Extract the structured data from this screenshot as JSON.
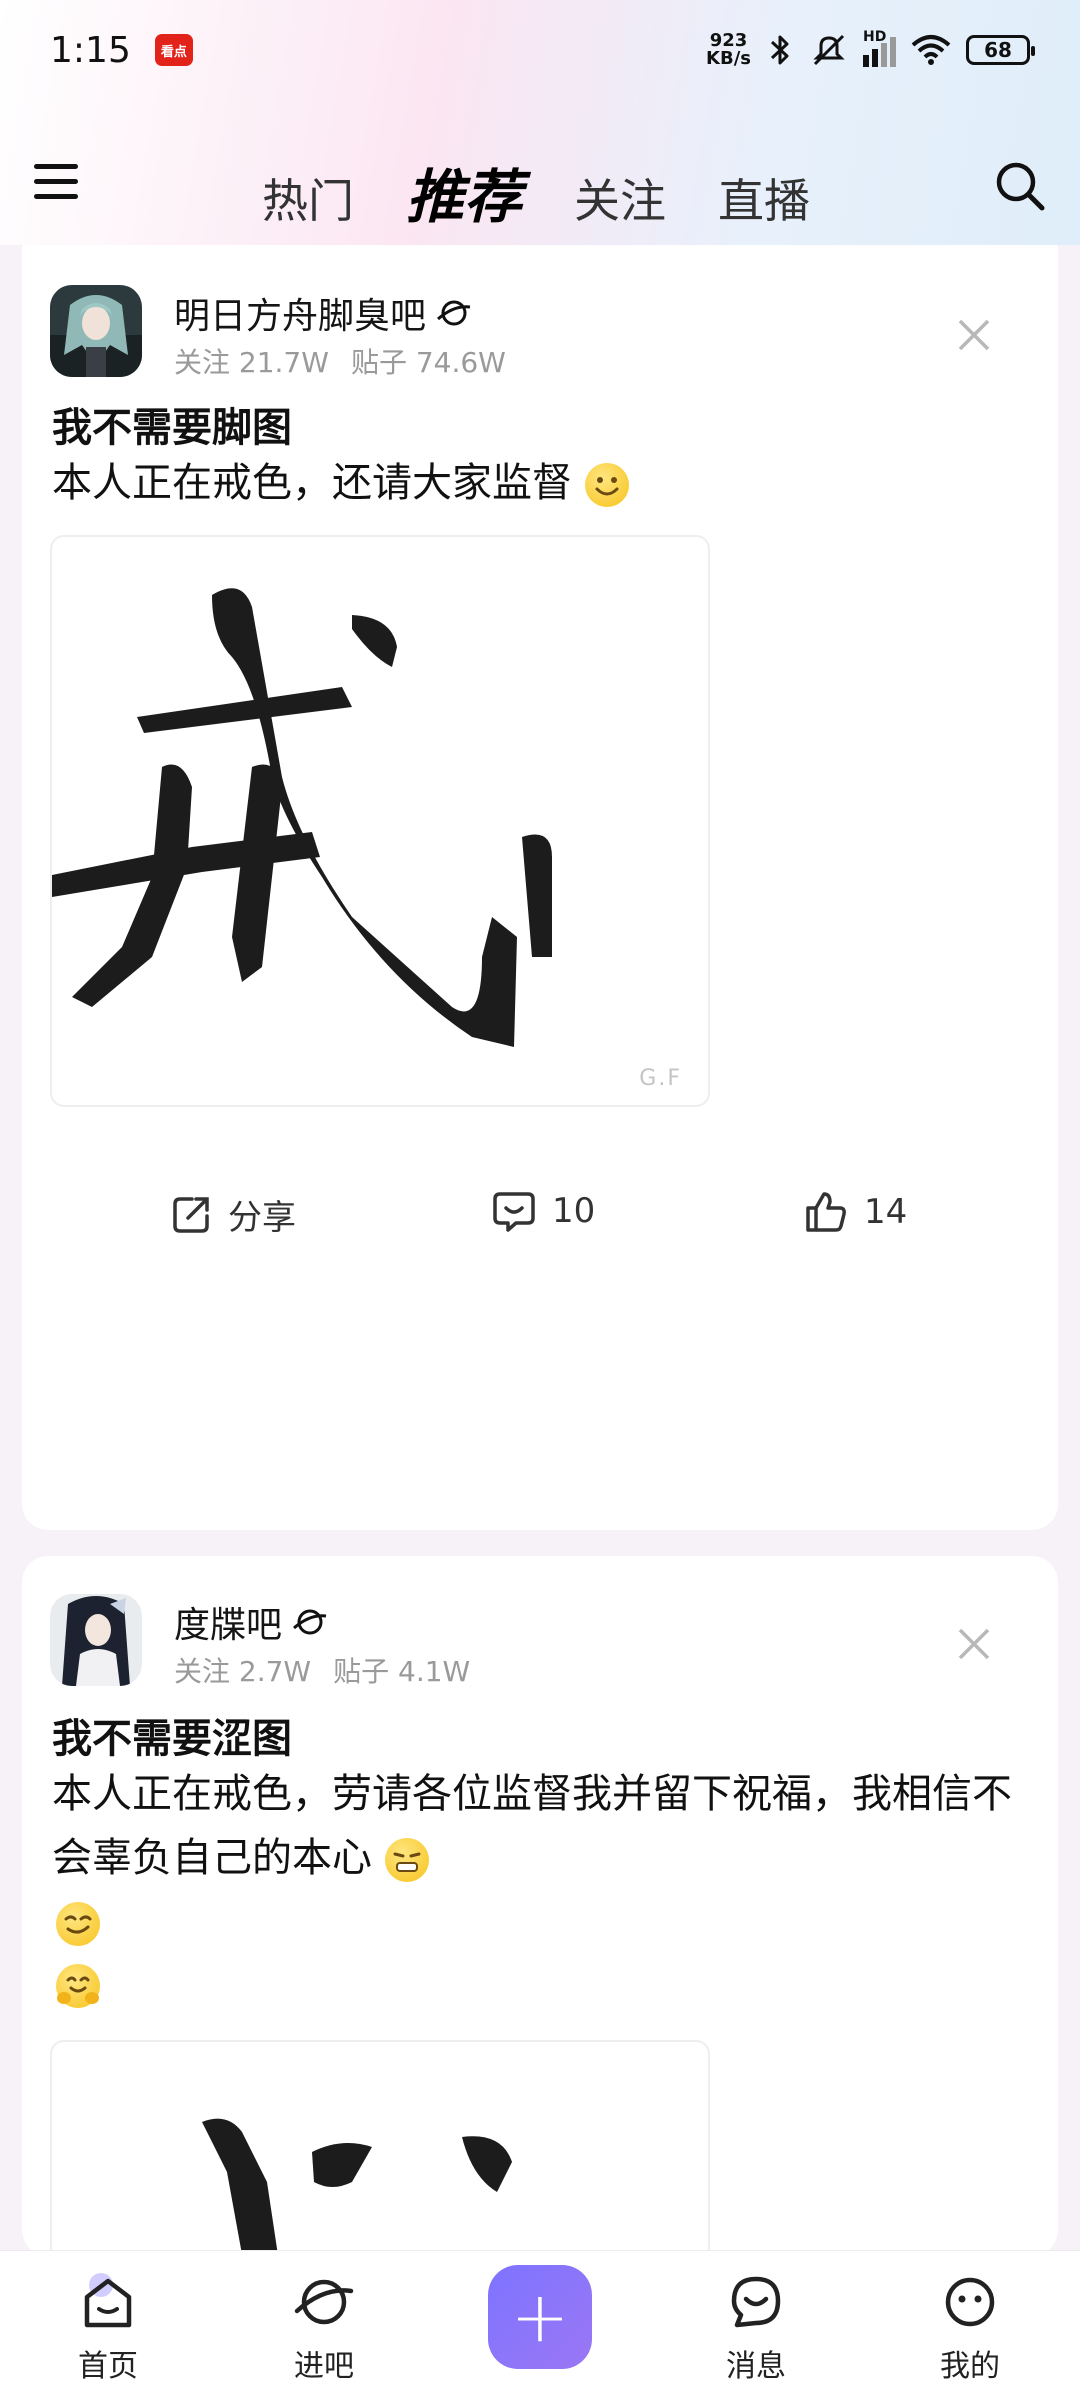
{
  "status_bar": {
    "time": "1:15",
    "app_badge": "看点",
    "net_speed_value": "923",
    "net_speed_unit": "KB/s",
    "network_label": "HD",
    "battery": "68"
  },
  "nav": {
    "tabs": [
      {
        "label": "热门",
        "active": false
      },
      {
        "label": "推荐",
        "active": true
      },
      {
        "label": "关注",
        "active": false
      },
      {
        "label": "直播",
        "active": false
      }
    ],
    "menu_icon": "hamburger-icon",
    "search_icon": "search-icon"
  },
  "posts": [
    {
      "forum_name": "明日方舟脚臭吧",
      "follow_label": "关注 21.7W",
      "posts_label": "贴子 74.6W",
      "title": "我不需要脚图",
      "body": "本人正在戒色，还请大家监督",
      "body_emoji": "smile",
      "image_char": "戒",
      "image_tag": "G.F",
      "actions": {
        "share": "分享",
        "comments": "10",
        "likes": "14"
      }
    },
    {
      "forum_name": "度牒吧",
      "follow_label": "关注 2.7W",
      "posts_label": "贴子 4.1W",
      "title": "我不需要涩图",
      "body": "本人正在戒色，劳请各位监督我并留下祝福，我相信不会辜负自己的本心",
      "body_emoji": "grimace",
      "extra_emojis": [
        "smirk",
        "hug"
      ],
      "image_char": "心"
    }
  ],
  "bottom_nav": [
    {
      "label": "首页",
      "icon": "home-icon",
      "active": true
    },
    {
      "label": "进吧",
      "icon": "planet-icon",
      "active": false
    },
    {
      "label": "",
      "icon": "plus-icon",
      "active": false
    },
    {
      "label": "消息",
      "icon": "message-icon",
      "active": false
    },
    {
      "label": "我的",
      "icon": "profile-icon",
      "active": false
    }
  ],
  "colors": {
    "accent": "#8577ff",
    "text_primary": "#111111",
    "text_secondary": "#9a9a9a",
    "card_bg": "#ffffff",
    "page_bg": "#f6f2f7"
  }
}
